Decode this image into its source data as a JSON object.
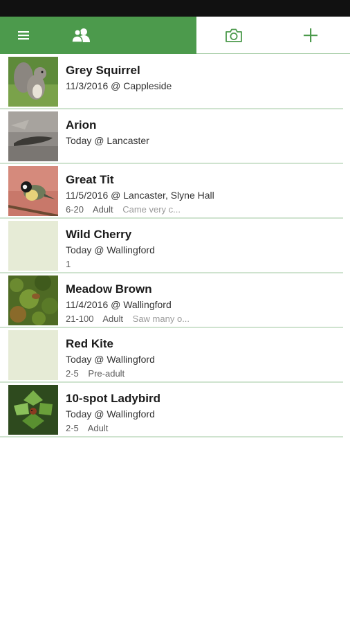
{
  "toolbar": {
    "menu_icon": "hamburger-menu-icon",
    "group_icon": "users-icon",
    "camera_icon": "camera-icon",
    "add_icon": "plus-icon",
    "colors": {
      "accent": "#4c9a4c",
      "status_bar": "#111111"
    }
  },
  "records": [
    {
      "title": "Grey Squirrel",
      "subtitle": "11/3/2016 @ Cappleside",
      "count": "",
      "stage": "",
      "comment": ""
    },
    {
      "title": "Arion",
      "subtitle": "Today @ Lancaster",
      "count": "",
      "stage": "",
      "comment": ""
    },
    {
      "title": "Great Tit",
      "subtitle": "11/5/2016 @ Lancaster, Slyne Hall",
      "count": "6-20",
      "stage": "Adult",
      "comment": "Came very c..."
    },
    {
      "title": "Wild Cherry",
      "subtitle": "Today @ Wallingford",
      "count": "1",
      "stage": "",
      "comment": ""
    },
    {
      "title": "Meadow Brown",
      "subtitle": "11/4/2016 @ Wallingford",
      "count": "21-100",
      "stage": "Adult",
      "comment": "Saw many o..."
    },
    {
      "title": "Red Kite",
      "subtitle": "Today @ Wallingford",
      "count": "2-5",
      "stage": "Pre-adult",
      "comment": ""
    },
    {
      "title": "10-spot Ladybird",
      "subtitle": "Today @ Wallingford",
      "count": "2-5",
      "stage": "Adult",
      "comment": ""
    }
  ]
}
